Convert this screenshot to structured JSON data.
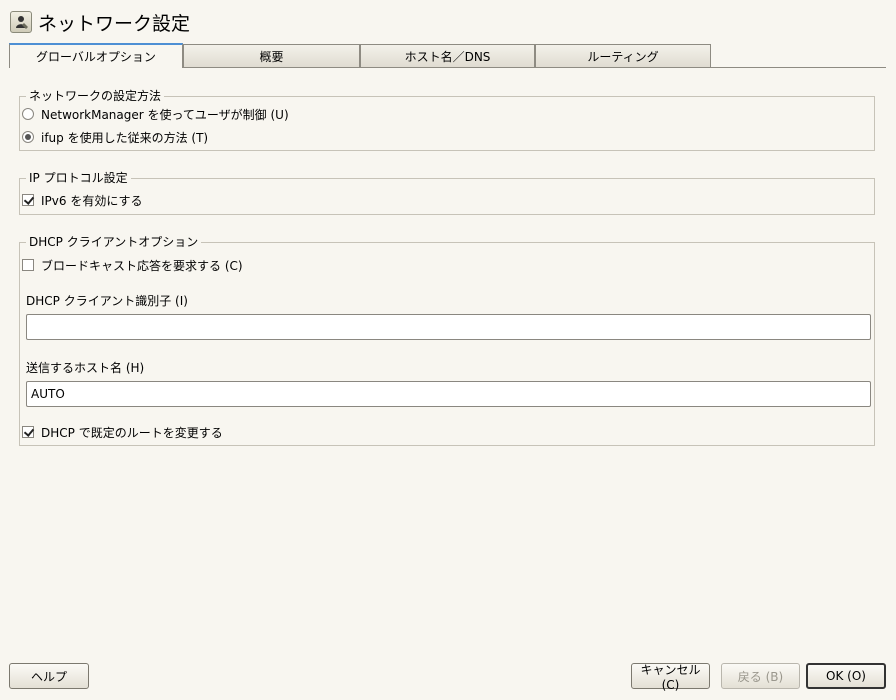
{
  "window": {
    "title": "ネットワーク設定",
    "icon": "network-settings-icon"
  },
  "tabs": [
    {
      "label": "グローバルオプション",
      "active": true
    },
    {
      "label": "概要",
      "active": false
    },
    {
      "label": "ホスト名／DNS",
      "active": false
    },
    {
      "label": "ルーティング",
      "active": false
    }
  ],
  "network_setup": {
    "legend": "ネットワークの設定方法",
    "options": [
      {
        "label": "NetworkManager を使ってユーザが制御 (U)",
        "selected": false
      },
      {
        "label": "ifup を使用した従来の方法 (T)",
        "selected": true
      }
    ]
  },
  "ip_protocol": {
    "legend": "IP プロトコル設定",
    "ipv6_label": "IPv6 を有効にする",
    "ipv6_checked": true
  },
  "dhcp": {
    "legend": "DHCP クライアントオプション",
    "broadcast_label": "ブロードキャスト応答を要求する (C)",
    "broadcast_checked": false,
    "client_id_label": "DHCP クライアント識別子 (I)",
    "client_id_value": "",
    "hostname_label": "送信するホスト名 (H)",
    "hostname_value": "AUTO",
    "default_route_label": "DHCP で既定のルートを変更する",
    "default_route_checked": true
  },
  "buttons": {
    "help": "ヘルプ",
    "cancel": "キャンセル (C)",
    "back": "戻る (B)",
    "ok": "OK (O)"
  }
}
